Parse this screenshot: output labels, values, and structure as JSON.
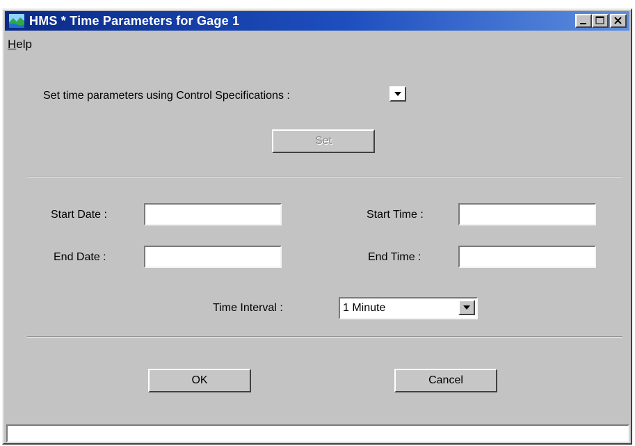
{
  "window": {
    "title": "HMS * Time Parameters for Gage 1"
  },
  "menu": {
    "help_label": "Help"
  },
  "control_spec": {
    "label": "Set time parameters using Control Specifications :",
    "set_button": "Set"
  },
  "fields": {
    "start_date_label": "Start Date :",
    "start_date_value": "",
    "start_time_label": "Start Time :",
    "start_time_value": "",
    "end_date_label": "End Date :",
    "end_date_value": "",
    "end_time_label": "End Time :",
    "end_time_value": ""
  },
  "time_interval": {
    "label": "Time Interval :",
    "selected": "1 Minute"
  },
  "buttons": {
    "ok": "OK",
    "cancel": "Cancel"
  },
  "status_bar": {
    "text": ""
  }
}
